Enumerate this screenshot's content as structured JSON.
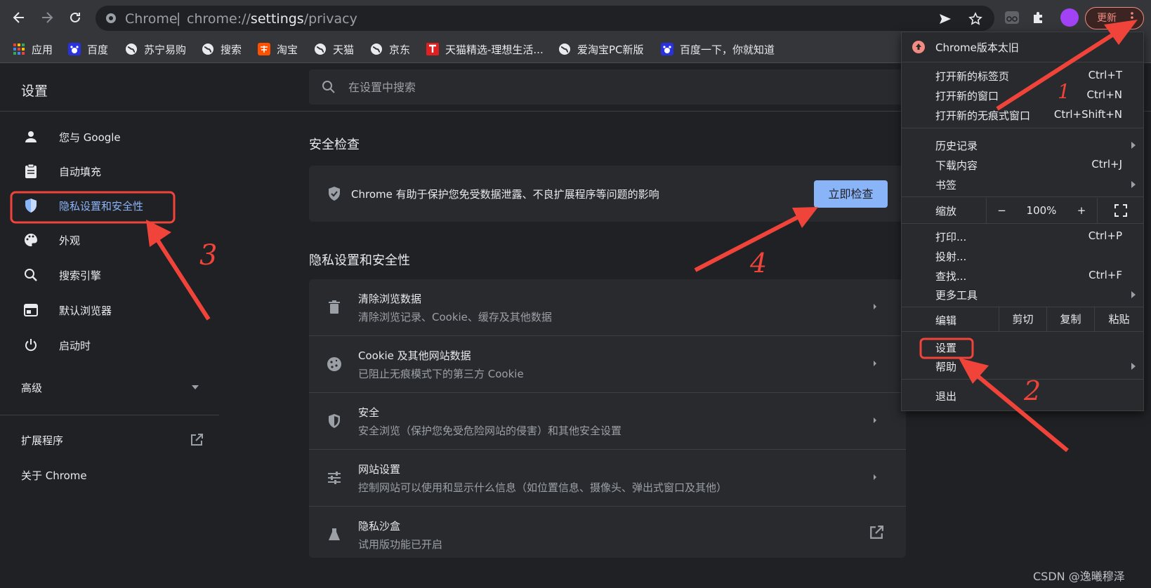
{
  "toolbar": {
    "back_icon": "arrow-left-icon",
    "forward_icon": "arrow-right-icon",
    "reload_icon": "reload-icon",
    "omnibox_origin": "Chrome",
    "omnibox_sep": "|",
    "omnibox_url_prefix": "chrome://",
    "omnibox_url_host": "settings",
    "omnibox_url_path": "/privacy",
    "update_label": "更新"
  },
  "bookmarks": [
    {
      "label": "应用",
      "icon": "apps-grid-icon"
    },
    {
      "label": "百度",
      "icon": "baidu-icon"
    },
    {
      "label": "苏宁易购",
      "icon": "globe-icon"
    },
    {
      "label": "搜索",
      "icon": "globe-icon"
    },
    {
      "label": "淘宝",
      "icon": "taobao-icon"
    },
    {
      "label": "天猫",
      "icon": "globe-icon"
    },
    {
      "label": "京东",
      "icon": "globe-icon"
    },
    {
      "label": "天猫精选-理想生活...",
      "icon": "tmall-icon"
    },
    {
      "label": "爱淘宝PC新版",
      "icon": "globe-icon"
    },
    {
      "label": "百度一下，你就知道",
      "icon": "baidu-icon"
    }
  ],
  "settings": {
    "title": "设置",
    "search_placeholder": "在设置中搜索"
  },
  "sidebar": {
    "items": [
      {
        "label": "您与 Google",
        "icon": "person-icon"
      },
      {
        "label": "自动填充",
        "icon": "clipboard-icon"
      },
      {
        "label": "隐私设置和安全性",
        "icon": "shield-icon",
        "selected": true
      },
      {
        "label": "外观",
        "icon": "palette-icon"
      },
      {
        "label": "搜索引擎",
        "icon": "search-icon"
      },
      {
        "label": "默认浏览器",
        "icon": "browser-icon"
      },
      {
        "label": "启动时",
        "icon": "power-icon"
      }
    ],
    "advanced_label": "高级",
    "extensions_label": "扩展程序",
    "about_label": "关于 Chrome"
  },
  "safety_check": {
    "section_title": "安全检查",
    "description": "Chrome 有助于保护您免受数据泄露、不良扩展程序等问题的影响",
    "button_label": "立即检查"
  },
  "privacy": {
    "section_title": "隐私设置和安全性",
    "rows": [
      {
        "title": "清除浏览数据",
        "subtitle": "清除浏览记录、Cookie、缓存及其他数据",
        "icon": "trash-icon"
      },
      {
        "title": "Cookie 及其他网站数据",
        "subtitle": "已阻止无痕模式下的第三方 Cookie",
        "icon": "cookie-icon"
      },
      {
        "title": "安全",
        "subtitle": "安全浏览（保护您免受危险网站的侵害）和其他安全设置",
        "icon": "shield-outline-icon"
      },
      {
        "title": "网站设置",
        "subtitle": "控制网站可以使用和显示什么信息（如位置信息、摄像头、弹出式窗口及其他）",
        "icon": "sliders-icon"
      },
      {
        "title": "隐私沙盒",
        "subtitle": "试用版功能已开启",
        "icon": "flask-icon"
      }
    ]
  },
  "menu": {
    "update_notice": "Chrome版本太旧",
    "new_tab": "打开新的标签页",
    "new_tab_sc": "Ctrl+T",
    "new_window": "打开新的窗口",
    "new_window_sc": "Ctrl+N",
    "incognito": "打开新的无痕式窗口",
    "incognito_sc": "Ctrl+Shift+N",
    "history": "历史记录",
    "downloads": "下载内容",
    "downloads_sc": "Ctrl+J",
    "bookmarks": "书签",
    "zoom": "缩放",
    "zoom_minus": "−",
    "zoom_value": "100%",
    "zoom_plus": "+",
    "print": "打印...",
    "print_sc": "Ctrl+P",
    "cast": "投射...",
    "find": "查找...",
    "find_sc": "Ctrl+F",
    "more_tools": "更多工具",
    "edit": "编辑",
    "cut": "剪切",
    "copy": "复制",
    "paste": "粘贴",
    "settings": "设置",
    "help": "帮助",
    "exit": "退出"
  },
  "annotations": {
    "n1": "1",
    "n2": "2",
    "n3": "3",
    "n4": "4",
    "color": "#f0443a"
  },
  "watermark": "CSDN @逸曦穆泽"
}
